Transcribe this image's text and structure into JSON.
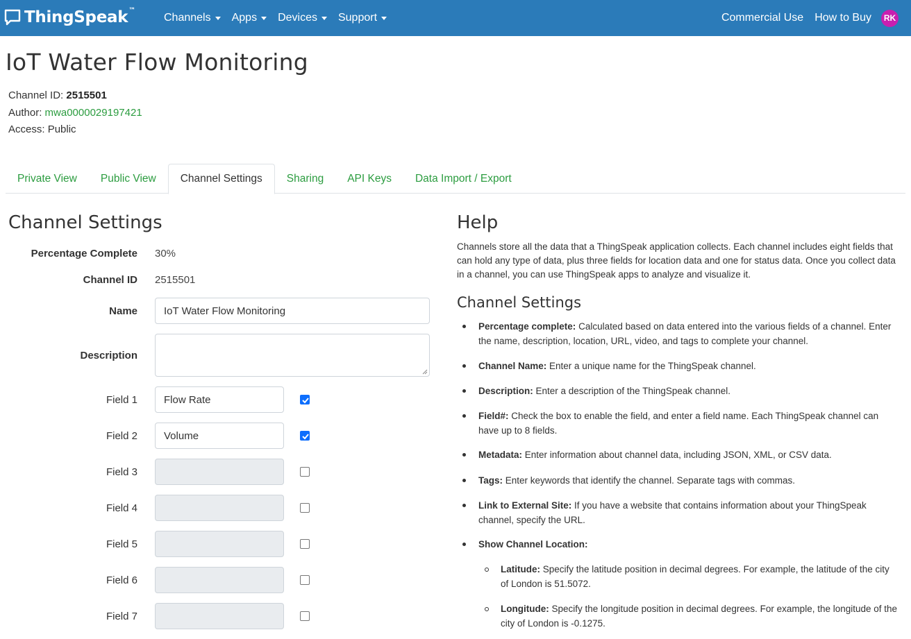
{
  "navbar": {
    "brand": "ThingSpeak",
    "brand_tm": "™",
    "menu": [
      "Channels",
      "Apps",
      "Devices",
      "Support"
    ],
    "right_links": [
      "Commercial Use",
      "How to Buy"
    ],
    "avatar_initials": "RK",
    "bg_color": "#2b7bb9",
    "avatar_color": "#c81fb0"
  },
  "page": {
    "title": "IoT Water Flow Monitoring",
    "channel_id_label": "Channel ID:",
    "channel_id": "2515501",
    "author_label": "Author:",
    "author": "mwa0000029197421",
    "access_label": "Access:",
    "access": "Public"
  },
  "tabs": [
    "Private View",
    "Public View",
    "Channel Settings",
    "Sharing",
    "API Keys",
    "Data Import / Export"
  ],
  "active_tab": "Channel Settings",
  "settings": {
    "title": "Channel Settings",
    "percentage_label": "Percentage Complete",
    "percentage_value": "30%",
    "channel_id_label": "Channel ID",
    "channel_id_value": "2515501",
    "name_label": "Name",
    "name_value": "IoT Water Flow Monitoring",
    "description_label": "Description",
    "description_value": "",
    "fields": [
      {
        "label": "Field 1",
        "value": "Flow Rate",
        "enabled": true
      },
      {
        "label": "Field 2",
        "value": "Volume",
        "enabled": true
      },
      {
        "label": "Field 3",
        "value": "",
        "enabled": false
      },
      {
        "label": "Field 4",
        "value": "",
        "enabled": false
      },
      {
        "label": "Field 5",
        "value": "",
        "enabled": false
      },
      {
        "label": "Field 6",
        "value": "",
        "enabled": false
      },
      {
        "label": "Field 7",
        "value": "",
        "enabled": false
      }
    ]
  },
  "help": {
    "title": "Help",
    "intro": "Channels store all the data that a ThingSpeak application collects. Each channel includes eight fields that can hold any type of data, plus three fields for location data and one for status data. Once you collect data in a channel, you can use ThingSpeak apps to analyze and visualize it.",
    "subtitle": "Channel Settings",
    "items": [
      {
        "term": "Percentage complete:",
        "text": " Calculated based on data entered into the various fields of a channel. Enter the name, description, location, URL, video, and tags to complete your channel."
      },
      {
        "term": "Channel Name:",
        "text": " Enter a unique name for the ThingSpeak channel."
      },
      {
        "term": "Description:",
        "text": " Enter a description of the ThingSpeak channel."
      },
      {
        "term": "Field#:",
        "text": " Check the box to enable the field, and enter a field name. Each ThingSpeak channel can have up to 8 fields."
      },
      {
        "term": "Metadata:",
        "text": " Enter information about channel data, including JSON, XML, or CSV data."
      },
      {
        "term": "Tags:",
        "text": " Enter keywords that identify the channel. Separate tags with commas."
      },
      {
        "term": "Link to External Site:",
        "text": " If you have a website that contains information about your ThingSpeak channel, specify the URL."
      },
      {
        "term": "Show Channel Location:",
        "text": ""
      }
    ],
    "sub_items": [
      {
        "term": "Latitude:",
        "text": " Specify the latitude position in decimal degrees. For example, the latitude of the city of London is 51.5072."
      },
      {
        "term": "Longitude:",
        "text": " Specify the longitude position in decimal degrees. For example, the longitude of the city of London is -0.1275."
      }
    ]
  }
}
